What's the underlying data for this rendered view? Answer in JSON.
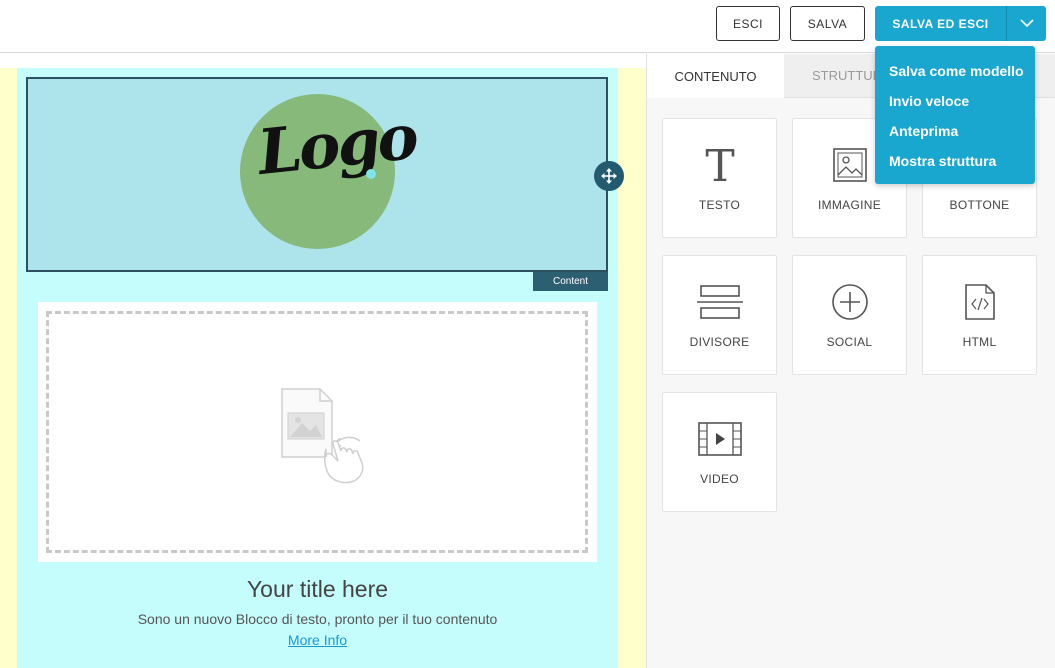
{
  "toolbar": {
    "exit_label": "ESCI",
    "save_label": "SALVA",
    "save_exit_label": "SALVA ED ESCI",
    "accent": "#1aa7cf"
  },
  "dropdown": {
    "items": [
      "Salva come modello",
      "Invio veloce",
      "Anteprima",
      "Mostra struttura"
    ]
  },
  "panel": {
    "tabs": [
      "CONTENUTO",
      "STRUTTURA"
    ],
    "tiles": [
      {
        "label": "TESTO",
        "icon": "text-icon"
      },
      {
        "label": "IMMAGINE",
        "icon": "image-icon"
      },
      {
        "label": "BOTTONE",
        "icon": "button-icon"
      },
      {
        "label": "DIVISORE",
        "icon": "divider-icon"
      },
      {
        "label": "SOCIAL",
        "icon": "social-icon"
      },
      {
        "label": "HTML",
        "icon": "html-icon"
      },
      {
        "label": "VIDEO",
        "icon": "video-icon"
      }
    ]
  },
  "editor": {
    "logo_text": "Logo",
    "content_tag": "Content",
    "title": "Your title here",
    "subtitle": "Sono un nuovo Blocco di testo, pronto per il tuo contenuto",
    "link": "More Info"
  }
}
